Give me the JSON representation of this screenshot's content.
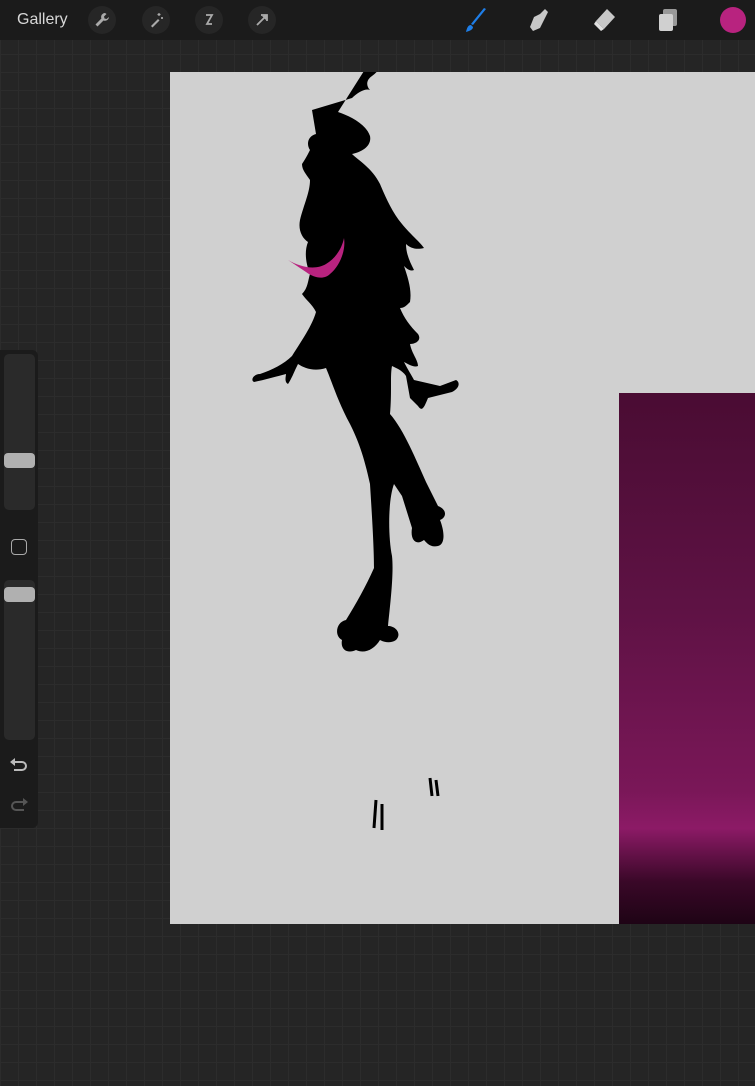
{
  "topbar": {
    "gallery_label": "Gallery",
    "left_tools": [
      "wrench-icon",
      "magic-wand-icon",
      "selection-icon",
      "transform-arrow-icon"
    ],
    "right_tools": [
      "brush-icon",
      "smudge-icon",
      "eraser-icon",
      "layers-icon"
    ],
    "active_tool": "brush",
    "accent_color": "#1e7ee8",
    "current_color": "#b8237f"
  },
  "sidebar": {
    "brush_size": 0.3,
    "opacity": 0.95
  }
}
